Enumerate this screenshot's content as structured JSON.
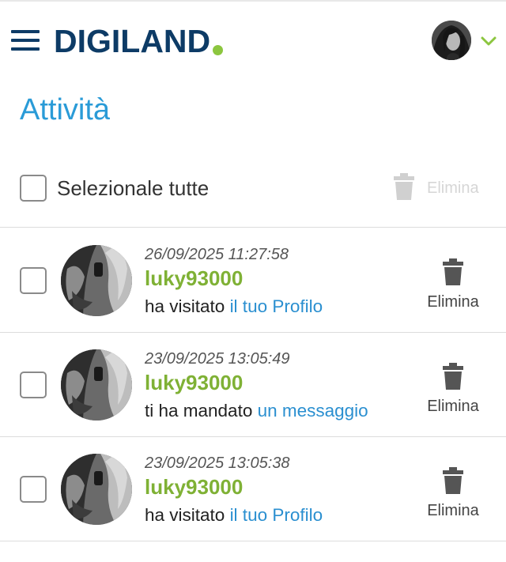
{
  "header": {
    "logo_text": "DIGILAND",
    "colors": {
      "brand_navy": "#0d3b66",
      "brand_green": "#8cc63f"
    }
  },
  "page": {
    "title": "Attività"
  },
  "toolbar": {
    "select_all_label": "Selezionale tutte",
    "delete_label": "Elimina"
  },
  "notifications": [
    {
      "date": "26/09/2025 11:27:58",
      "user": "luky93000",
      "action": "ha visitato ",
      "link": "il tuo Profilo",
      "delete_label": "Elimina"
    },
    {
      "date": "23/09/2025 13:05:49",
      "user": "luky93000",
      "action": "ti ha mandato ",
      "link": "un messaggio",
      "delete_label": "Elimina"
    },
    {
      "date": "23/09/2025 13:05:38",
      "user": "luky93000",
      "action": "ha visitato ",
      "link": "il tuo Profilo",
      "delete_label": "Elimina"
    }
  ],
  "icons": [
    "menu-icon",
    "chevron-down-icon",
    "trash-icon"
  ],
  "colors": {
    "title_blue": "#2a9bd7",
    "username_green": "#7fb135",
    "link_blue": "#2a8fd0"
  }
}
